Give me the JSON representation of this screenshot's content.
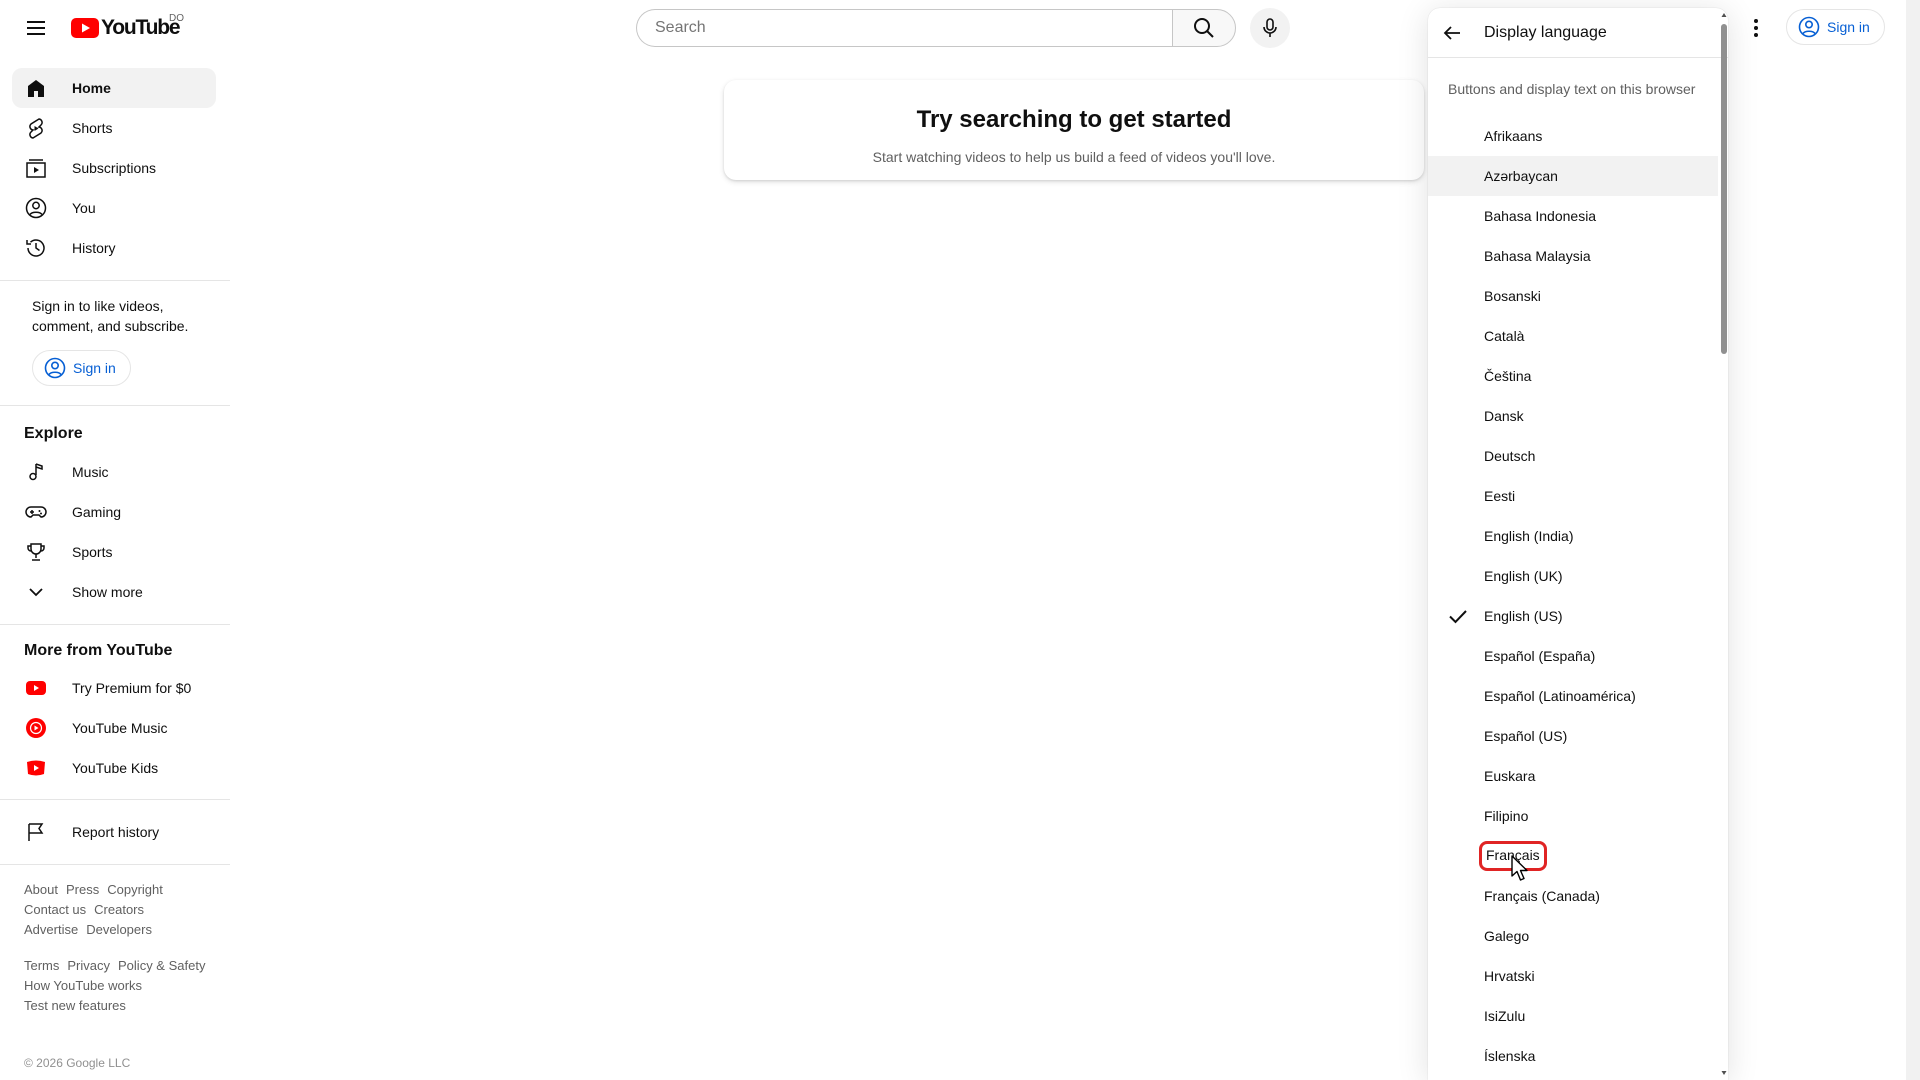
{
  "header": {
    "logo_text": "YouTube",
    "country_code": "DO",
    "search_placeholder": "Search",
    "signin_label": "Sign in"
  },
  "guide": {
    "main_items": [
      {
        "label": "Home",
        "icon": "home-icon",
        "active": true
      },
      {
        "label": "Shorts",
        "icon": "shorts-icon"
      },
      {
        "label": "Subscriptions",
        "icon": "subscriptions-icon"
      },
      {
        "label": "You",
        "icon": "you-icon"
      },
      {
        "label": "History",
        "icon": "history-icon"
      }
    ],
    "signin_prompt": "Sign in to like videos, comment, and subscribe.",
    "signin_label": "Sign in",
    "explore_heading": "Explore",
    "explore_items": [
      {
        "label": "Music",
        "icon": "music-icon"
      },
      {
        "label": "Gaming",
        "icon": "gaming-icon"
      },
      {
        "label": "Sports",
        "icon": "sports-icon"
      },
      {
        "label": "Show more",
        "icon": "chevron-down-icon"
      }
    ],
    "more_heading": "More from YouTube",
    "more_items": [
      {
        "label": "Try Premium for $0",
        "icon": "youtube-premium-icon"
      },
      {
        "label": "YouTube Music",
        "icon": "youtube-music-icon"
      },
      {
        "label": "YouTube Kids",
        "icon": "youtube-kids-icon"
      }
    ],
    "report_history": "Report history",
    "footer_links_1": [
      "About",
      "Press",
      "Copyright",
      "Contact us",
      "Creators",
      "Advertise",
      "Developers"
    ],
    "footer_links_2": [
      "Terms",
      "Privacy",
      "Policy & Safety",
      "How YouTube works",
      "Test new features"
    ],
    "copyright": "© 2026 Google LLC"
  },
  "main": {
    "prompt_title": "Try searching to get started",
    "prompt_subtitle": "Start watching videos to help us build a feed of videos you'll love."
  },
  "language_menu": {
    "title": "Display language",
    "description": "Buttons and display text on this browser",
    "selected": "English (US)",
    "hovered": "Azərbaycan",
    "highlighted": "Français",
    "languages": [
      "Afrikaans",
      "Azərbaycan",
      "Bahasa Indonesia",
      "Bahasa Malaysia",
      "Bosanski",
      "Català",
      "Čeština",
      "Dansk",
      "Deutsch",
      "Eesti",
      "English (India)",
      "English (UK)",
      "English (US)",
      "Español (España)",
      "Español (Latinoamérica)",
      "Español (US)",
      "Euskara",
      "Filipino",
      "Français",
      "Français (Canada)",
      "Galego",
      "Hrvatski",
      "IsiZulu",
      "Íslenska"
    ]
  },
  "colors": {
    "brand_red": "#ff0000",
    "link_blue": "#065fd4",
    "highlight_box": "#e02424",
    "hover_bg": "#f2f2f2"
  }
}
